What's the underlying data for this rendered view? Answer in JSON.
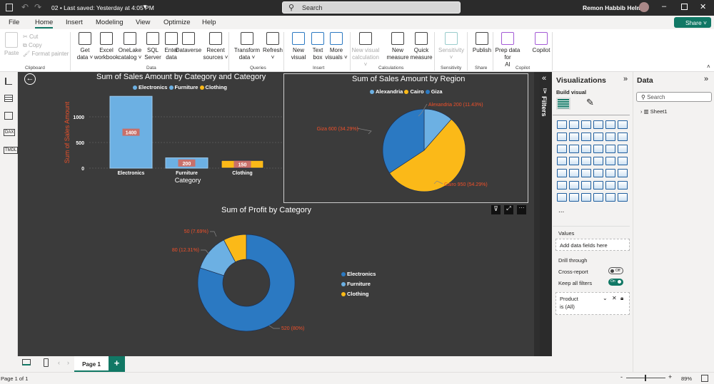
{
  "titlebar": {
    "file_title": "02 • Last saved: Yesterday at 4:05 PM",
    "search_placeholder": "Search",
    "user": "Remon Habbib Helmy"
  },
  "menu": [
    "File",
    "Home",
    "Insert",
    "Modeling",
    "View",
    "Optimize",
    "Help"
  ],
  "share_label": "Share",
  "ribbon": {
    "clipboard": {
      "paste": "Paste",
      "cut": "Cut",
      "copy": "Copy",
      "format_painter": "Format painter",
      "group": "Clipboard"
    },
    "data": {
      "buttons": [
        {
          "l1": "Get",
          "l2": "data ˅"
        },
        {
          "l1": "Excel",
          "l2": "workbook"
        },
        {
          "l1": "OneLake",
          "l2": "catalog ˅"
        },
        {
          "l1": "SQL",
          "l2": "Server"
        },
        {
          "l1": "Enter",
          "l2": "data"
        },
        {
          "l1": "Dataverse",
          "l2": ""
        },
        {
          "l1": "Recent",
          "l2": "sources ˅"
        }
      ],
      "group": "Data"
    },
    "queries": {
      "buttons": [
        {
          "l1": "Transform",
          "l2": "data ˅"
        },
        {
          "l1": "Refresh",
          "l2": "˅"
        }
      ],
      "group": "Queries"
    },
    "insert": {
      "buttons": [
        {
          "l1": "New",
          "l2": "visual"
        },
        {
          "l1": "Text",
          "l2": "box"
        },
        {
          "l1": "More",
          "l2": "visuals ˅"
        }
      ],
      "group": "Insert"
    },
    "calculations": {
      "buttons": [
        {
          "l1": "New visual",
          "l2": "calculation ˅"
        },
        {
          "l1": "New",
          "l2": "measure"
        },
        {
          "l1": "Quick",
          "l2": "measure"
        }
      ],
      "group": "Calculations"
    },
    "sensitivity": {
      "buttons": [
        {
          "l1": "Sensitivity",
          "l2": "˅"
        }
      ],
      "group": "Sensitivity"
    },
    "share": {
      "buttons": [
        {
          "l1": "Publish",
          "l2": ""
        }
      ],
      "group": "Share"
    },
    "copilot": {
      "buttons": [
        {
          "l1": "Prep data for",
          "l2": "AI"
        },
        {
          "l1": "Copilot",
          "l2": ""
        }
      ],
      "group": "Copilot"
    }
  },
  "colors": {
    "light_blue": "#6cb0e3",
    "blue": "#2b79c2",
    "yellow": "#fbb918",
    "label_red": "#f0502a",
    "axis_title": "#e8502a",
    "canvas": "#3b3b3b",
    "accent": "#117865"
  },
  "chart_data": [
    {
      "type": "bar",
      "title": "Sum of Sales Amount by Category and Category",
      "xlabel": "Category",
      "ylabel": "Sum of Sales Amount",
      "categories": [
        "Electronics",
        "Furniture",
        "Clothing"
      ],
      "values": [
        1400,
        200,
        150
      ],
      "data_labels": [
        "1400",
        "200",
        "150"
      ],
      "ylim": [
        0,
        1400
      ],
      "yticks": [
        {
          "v": 0,
          "t": "0"
        },
        {
          "v": 500,
          "t": "500"
        },
        {
          "v": 1000,
          "t": "1000"
        }
      ],
      "legend": [
        "Electronics",
        "Furniture",
        "Clothing"
      ],
      "legend_position": "top-center",
      "grid": true
    },
    {
      "type": "pie",
      "title": "Sum of Sales Amount by Region",
      "categories": [
        "Alexandria",
        "Cairo",
        "Giza"
      ],
      "values": [
        200,
        950,
        600
      ],
      "data_labels": [
        "Alexandria 200 (11.43%)",
        "Cairo 950 (54.29%)",
        "Giza 600 (34.29%)"
      ],
      "legend": [
        "Alexandria",
        "Cairo",
        "Giza"
      ],
      "legend_position": "top-center"
    },
    {
      "type": "pie",
      "variant": "donut",
      "title": "Sum of Profit by Category",
      "categories": [
        "Electronics",
        "Furniture",
        "Clothing"
      ],
      "values": [
        520,
        80,
        50
      ],
      "data_labels": [
        "520 (80%)",
        "80 (12.31%)",
        "50 (7.69%)"
      ],
      "legend": [
        "Electronics",
        "Furniture",
        "Clothing"
      ],
      "legend_position": "right"
    }
  ],
  "viz_pane": {
    "title": "Visualizations",
    "build_visual": "Build visual",
    "more": "...",
    "values_label": "Values",
    "add_fields": "Add data fields here",
    "drill_through": "Drill through",
    "cross_report": "Cross-report",
    "cross_report_state": "Off",
    "keep_filters": "Keep all filters",
    "keep_filters_state": "On",
    "filter_card": {
      "field": "Product",
      "value": "is (All)"
    }
  },
  "filters_label": "Filters",
  "data_pane": {
    "title": "Data",
    "search_placeholder": "Search",
    "tables": [
      "Sheet1"
    ]
  },
  "pages": {
    "tabs": [
      "Page 1"
    ],
    "add": "+"
  },
  "status": {
    "page_info": "Page 1 of 1",
    "zoom": "89%"
  }
}
